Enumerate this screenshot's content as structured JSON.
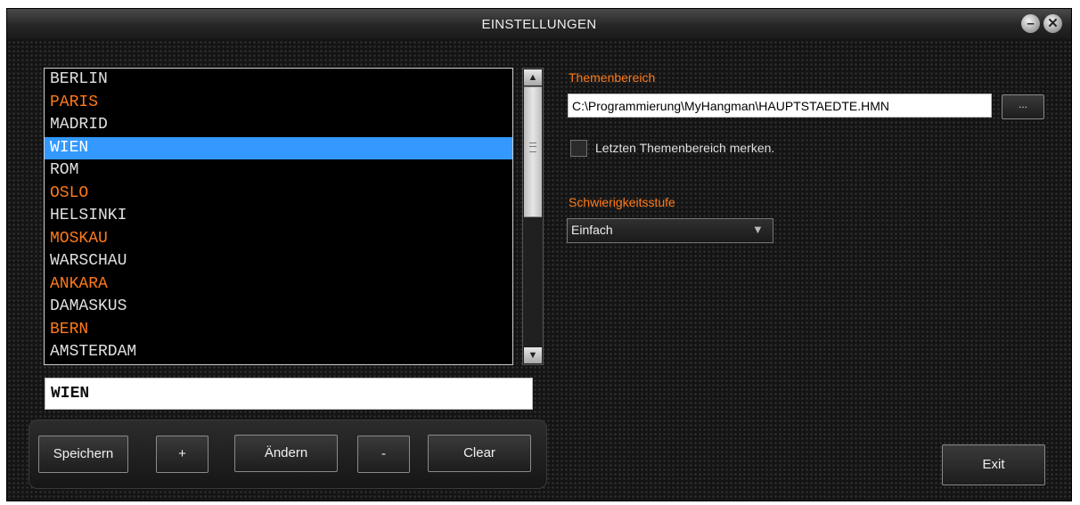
{
  "window": {
    "title": "EINSTELLUNGEN",
    "minimize_symbol": "–",
    "close_symbol": "✕"
  },
  "word_list": {
    "items": [
      {
        "label": "BERLIN",
        "color": "white"
      },
      {
        "label": "PARIS",
        "color": "orange"
      },
      {
        "label": "MADRID",
        "color": "white"
      },
      {
        "label": "WIEN",
        "color": "selected"
      },
      {
        "label": "ROM",
        "color": "white"
      },
      {
        "label": "OSLO",
        "color": "orange"
      },
      {
        "label": "HELSINKI",
        "color": "white"
      },
      {
        "label": "MOSKAU",
        "color": "orange"
      },
      {
        "label": "WARSCHAU",
        "color": "white"
      },
      {
        "label": "ANKARA",
        "color": "orange"
      },
      {
        "label": "DAMASKUS",
        "color": "white"
      },
      {
        "label": "BERN",
        "color": "orange"
      },
      {
        "label": "AMSTERDAM",
        "color": "white"
      }
    ],
    "selected_value": "WIEN",
    "scroll_up_symbol": "▲",
    "scroll_down_symbol": "▼"
  },
  "word_input": {
    "value": "WIEN"
  },
  "buttons": {
    "save": "Speichern",
    "add": "+",
    "edit": "Ändern",
    "remove": "-",
    "clear": "Clear",
    "exit": "Exit",
    "browse": "..."
  },
  "topic": {
    "label": "Themenbereich",
    "path": "C:\\Programmierung\\MyHangman\\HAUPTSTAEDTE.HMN",
    "remember_label": "Letzten Themenbereich merken.",
    "remember_checked": false
  },
  "difficulty": {
    "label": "Schwierigkeitsstufe",
    "selected": "Einfach",
    "arrow_symbol": "▼"
  },
  "colors": {
    "accent_orange": "#ff7a1a",
    "selection_blue": "#3399ff",
    "list_white": "#e0e0e0"
  }
}
